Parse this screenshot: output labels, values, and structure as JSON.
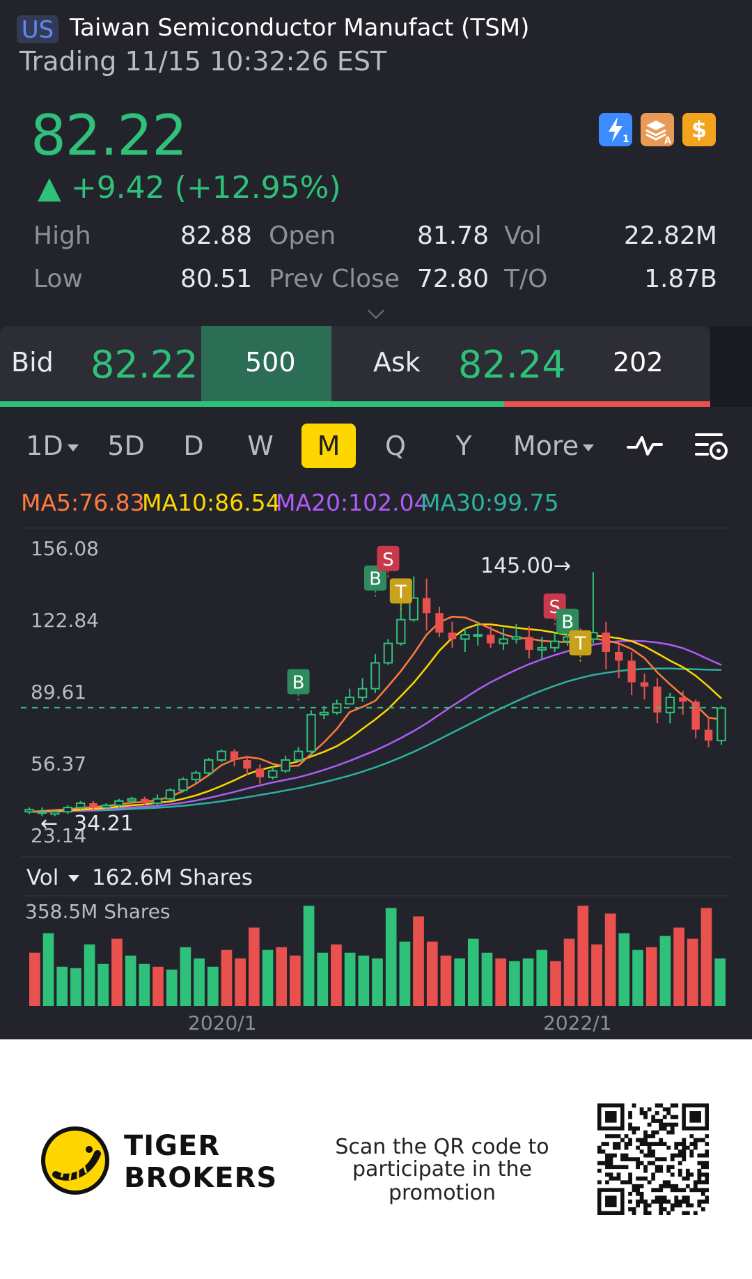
{
  "header": {
    "market": "US",
    "name": "Taiwan Semiconductor Manufact (TSM)",
    "status": "Trading 11/15 10:32:26 EST",
    "price": "82.22",
    "change": "▲ +9.42 (+12.95%)",
    "icons": [
      "lightning-icon",
      "layers-icon",
      "dollar-icon"
    ],
    "stats": {
      "high_label": "High",
      "high": "82.88",
      "low_label": "Low",
      "low": "80.51",
      "open_label": "Open",
      "open": "81.78",
      "prev_close_label": "Prev Close",
      "prev_close": "72.80",
      "vol_label": "Vol",
      "vol": "22.82M",
      "to_label": "T/O",
      "to": "1.87B"
    }
  },
  "orderbook": {
    "bid_label": "Bid",
    "bid_price": "82.22",
    "bid_size": "500",
    "ask_label": "Ask",
    "ask_price": "82.24",
    "ask_size": "202",
    "bid_fraction": 0.71
  },
  "periods": {
    "tabs": [
      "1D",
      "5D",
      "D",
      "W",
      "M",
      "Q",
      "Y",
      "More"
    ],
    "active": "M"
  },
  "ma": {
    "ma5": "MA5:76.83",
    "ma10": "MA10:86.54",
    "ma20": "MA20:102.04",
    "ma30": "MA30:99.75"
  },
  "colors": {
    "up": "#2fc07a",
    "down": "#e8514e",
    "ma5": "#ff7a3d",
    "ma10": "#ffd600",
    "ma20": "#b05cf7",
    "ma30": "#2ab3a0",
    "accent": "#ffd600"
  },
  "chart_data": {
    "type": "candlestick",
    "y_ticks": [
      "156.08",
      "122.84",
      "89.61",
      "56.37",
      "23.14"
    ],
    "ylim": [
      23.14,
      156.08
    ],
    "current_price": 82.22,
    "high_annotation": "145.00",
    "low_annotation": "34.21",
    "x_labels": [
      "2020/1",
      "2022/1"
    ],
    "markers": [
      "B",
      "S",
      "T",
      "B",
      "S",
      "B",
      "T"
    ],
    "candles": [
      [
        34,
        35,
        36,
        33
      ],
      [
        34,
        34,
        36,
        32
      ],
      [
        33,
        34,
        35,
        32
      ],
      [
        34,
        36,
        37,
        33
      ],
      [
        36,
        38,
        39,
        35
      ],
      [
        38,
        36,
        39,
        35
      ],
      [
        36,
        37,
        38,
        35
      ],
      [
        37,
        39,
        40,
        36
      ],
      [
        39,
        40,
        41,
        38
      ],
      [
        40,
        38,
        41,
        37
      ],
      [
        38,
        40,
        42,
        37
      ],
      [
        40,
        44,
        45,
        39
      ],
      [
        44,
        49,
        50,
        43
      ],
      [
        49,
        52,
        53,
        47
      ],
      [
        52,
        58,
        59,
        51
      ],
      [
        58,
        62,
        63,
        57
      ],
      [
        62,
        58,
        63,
        55
      ],
      [
        58,
        54,
        60,
        51
      ],
      [
        54,
        50,
        56,
        47
      ],
      [
        50,
        53,
        55,
        49
      ],
      [
        53,
        58,
        60,
        52
      ],
      [
        58,
        62,
        64,
        57
      ],
      [
        62,
        79,
        81,
        60
      ],
      [
        79,
        80,
        83,
        77
      ],
      [
        80,
        84,
        86,
        79
      ],
      [
        84,
        87,
        91,
        84
      ],
      [
        87,
        91,
        96,
        85
      ],
      [
        91,
        103,
        107,
        89
      ],
      [
        103,
        112,
        114,
        102
      ],
      [
        112,
        123,
        130,
        111
      ],
      [
        123,
        133,
        143,
        122
      ],
      [
        133,
        126,
        142,
        118
      ],
      [
        126,
        117,
        129,
        115
      ],
      [
        117,
        114,
        122,
        110
      ],
      [
        114,
        116,
        119,
        108
      ],
      [
        116,
        116,
        122,
        111
      ],
      [
        116,
        112,
        120,
        110
      ],
      [
        112,
        114,
        119,
        109
      ],
      [
        114,
        115,
        121,
        112
      ],
      [
        115,
        109,
        120,
        105
      ],
      [
        109,
        110,
        115,
        105
      ],
      [
        110,
        113,
        117,
        108
      ],
      [
        113,
        115,
        120,
        111
      ],
      [
        115,
        114,
        119,
        108
      ],
      [
        114,
        117,
        145,
        112
      ],
      [
        117,
        108,
        122,
        100
      ],
      [
        108,
        104,
        112,
        96
      ],
      [
        104,
        94,
        108,
        88
      ],
      [
        94,
        92,
        98,
        86
      ],
      [
        92,
        80,
        96,
        75
      ],
      [
        80,
        87,
        89,
        75
      ],
      [
        87,
        85,
        90,
        79
      ],
      [
        85,
        72,
        86,
        68
      ],
      [
        72,
        67,
        78,
        64
      ],
      [
        67,
        82,
        83,
        65
      ]
    ],
    "ma5": [
      34,
      34.4,
      34.8,
      35.2,
      35.8,
      36.2,
      36.8,
      37.4,
      38.2,
      38.6,
      39.4,
      41,
      43.6,
      47,
      51,
      55.6,
      58.2,
      59.4,
      58.6,
      56.2,
      55,
      55.4,
      60.8,
      66.2,
      72.4,
      80.2,
      82.6,
      85.4,
      92.2,
      99.2,
      107.2,
      116,
      121.8,
      124.4,
      124,
      121.6,
      118.8,
      116.2,
      114.6,
      114.2,
      113.2,
      112.8,
      112.6,
      112.6,
      114.2,
      113.4,
      112,
      109.4,
      105.2,
      98.6,
      93,
      87.8,
      83.4,
      77.6,
      76.8
    ],
    "ma10": [
      34,
      34.2,
      34.4,
      34.6,
      35,
      35.4,
      35.8,
      36.4,
      37,
      37.4,
      38.2,
      38.8,
      40,
      41.6,
      43.6,
      46,
      48.6,
      51.4,
      53.4,
      54.8,
      55.8,
      57.4,
      59.6,
      61.8,
      64.4,
      68,
      72.4,
      76.8,
      81.6,
      87.6,
      93.8,
      101,
      108.6,
      114.6,
      118.8,
      120.8,
      120.8,
      120,
      119.2,
      118.6,
      118,
      117,
      116,
      115.4,
      115.6,
      115.2,
      114.4,
      113,
      110.6,
      107.4,
      104,
      101,
      97,
      92,
      86.5
    ],
    "ma20": [
      34,
      34.1,
      34.2,
      34.4,
      34.6,
      34.8,
      35.2,
      35.6,
      36,
      36.4,
      36.8,
      37.4,
      38.2,
      39.2,
      40.4,
      41.8,
      43.2,
      44.8,
      46.2,
      47.6,
      48.8,
      50,
      51.6,
      53.4,
      55.4,
      57.6,
      60,
      62.4,
      65.2,
      68.2,
      71.4,
      75,
      79,
      83,
      86.8,
      90.6,
      94,
      97,
      99.8,
      102.4,
      104.6,
      106.6,
      108.4,
      110,
      111.4,
      112.4,
      113,
      113.2,
      113,
      112.4,
      111.4,
      109.8,
      107.4,
      104.6,
      102
    ],
    "ma30": [
      34,
      34.1,
      34.2,
      34.3,
      34.4,
      34.6,
      34.8,
      35,
      35.3,
      35.6,
      35.9,
      36.3,
      36.8,
      37.4,
      38.1,
      38.9,
      39.8,
      40.8,
      41.8,
      42.8,
      43.9,
      45,
      46.3,
      47.7,
      49.2,
      50.8,
      52.6,
      54.6,
      56.8,
      59.2,
      61.8,
      64.6,
      67.6,
      70.6,
      73.6,
      76.6,
      79.6,
      82.4,
      85.2,
      87.8,
      90.2,
      92.4,
      94.4,
      96,
      97.4,
      98.4,
      99.2,
      99.8,
      100.2,
      100.4,
      100.4,
      100.2,
      100,
      99.8,
      99.75
    ]
  },
  "volume": {
    "label": "Vol",
    "value": "162.6M Shares",
    "max_label": "358.5M Shares",
    "max": 358.5,
    "bars": [
      [
        190,
        "d"
      ],
      [
        260,
        "u"
      ],
      [
        140,
        "u"
      ],
      [
        135,
        "u"
      ],
      [
        220,
        "u"
      ],
      [
        150,
        "u"
      ],
      [
        240,
        "d"
      ],
      [
        180,
        "u"
      ],
      [
        150,
        "u"
      ],
      [
        140,
        "d"
      ],
      [
        130,
        "u"
      ],
      [
        210,
        "u"
      ],
      [
        170,
        "u"
      ],
      [
        140,
        "u"
      ],
      [
        200,
        "d"
      ],
      [
        170,
        "d"
      ],
      [
        280,
        "d"
      ],
      [
        200,
        "u"
      ],
      [
        210,
        "d"
      ],
      [
        180,
        "d"
      ],
      [
        358,
        "u"
      ],
      [
        190,
        "u"
      ],
      [
        220,
        "d"
      ],
      [
        190,
        "u"
      ],
      [
        180,
        "u"
      ],
      [
        170,
        "u"
      ],
      [
        350,
        "u"
      ],
      [
        230,
        "u"
      ],
      [
        320,
        "d"
      ],
      [
        230,
        "d"
      ],
      [
        180,
        "d"
      ],
      [
        170,
        "u"
      ],
      [
        240,
        "u"
      ],
      [
        190,
        "u"
      ],
      [
        170,
        "d"
      ],
      [
        160,
        "u"
      ],
      [
        170,
        "u"
      ],
      [
        200,
        "u"
      ],
      [
        160,
        "d"
      ],
      [
        240,
        "d"
      ],
      [
        358,
        "d"
      ],
      [
        220,
        "d"
      ],
      [
        330,
        "d"
      ],
      [
        260,
        "u"
      ],
      [
        200,
        "u"
      ],
      [
        210,
        "d"
      ],
      [
        250,
        "u"
      ],
      [
        280,
        "d"
      ],
      [
        240,
        "d"
      ],
      [
        350,
        "d"
      ],
      [
        170,
        "u"
      ]
    ]
  },
  "footer": {
    "brand_line1": "TIGER",
    "brand_line2": "BROKERS",
    "promo_line1": "Scan the QR code to",
    "promo_line2": "participate in the promotion"
  }
}
